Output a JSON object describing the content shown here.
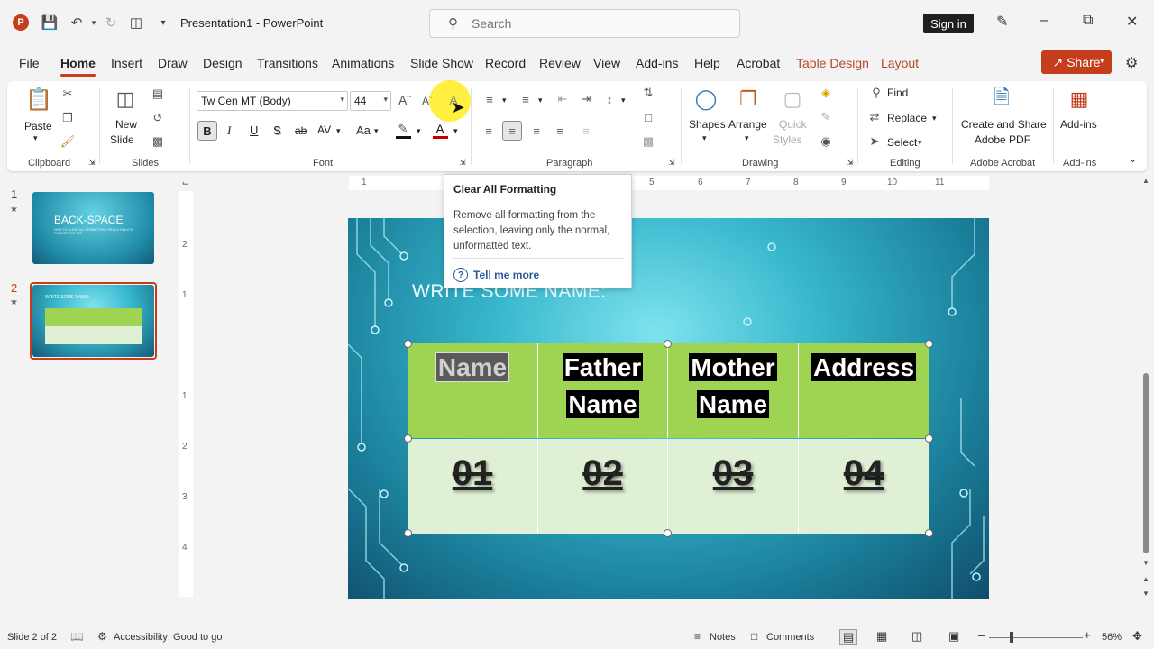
{
  "app": {
    "logo_letter": "P",
    "doc_title": "Presentation1  -  PowerPoint",
    "search_placeholder": "Search",
    "signin_label": "Sign in",
    "share_label": "Share"
  },
  "tabs": [
    "File",
    "Home",
    "Insert",
    "Draw",
    "Design",
    "Transitions",
    "Animations",
    "Slide Show",
    "Record",
    "Review",
    "View",
    "Add-ins",
    "Help",
    "Acrobat",
    "Table Design",
    "Layout"
  ],
  "ribbon": {
    "clipboard": {
      "paste": "Paste",
      "label": "Clipboard"
    },
    "slides": {
      "new_slide": "New",
      "new_slide2": "Slide",
      "label": "Slides"
    },
    "font": {
      "font_name": "Tw Cen MT (Body)",
      "font_size": "44",
      "label": "Font",
      "bold": "B",
      "italic": "I",
      "underline": "U",
      "strike": "S",
      "abc": "ab",
      "av": "AV",
      "aa": "Aa"
    },
    "paragraph": {
      "label": "Paragraph"
    },
    "drawing": {
      "shapes": "Shapes",
      "arrange": "Arrange",
      "quick": "Quick",
      "styles": "Styles",
      "label": "Drawing"
    },
    "editing": {
      "find": "Find",
      "replace": "Replace",
      "select": "Select",
      "label": "Editing"
    },
    "acrobat": {
      "line1": "Create and Share",
      "line2": "Adobe PDF",
      "label": "Adobe Acrobat"
    },
    "addins": {
      "btn": "Add-ins",
      "label": "Add-ins"
    }
  },
  "tooltip": {
    "title": "Clear All Formatting",
    "body": "Remove all formatting from the selection, leaving only the normal, unformatted text.",
    "more": "Tell me more"
  },
  "thumbnails": [
    {
      "num": "1",
      "title": "BACK-SPACE",
      "subtitle": "HOW TO CLEAR ALL FORMATTING FROM A TABLE IN POWERPOINT 365"
    },
    {
      "num": "2",
      "title": "WRITE SOME NAME:"
    }
  ],
  "ruler": {
    "h": [
      "1",
      "5",
      "6",
      "7",
      "8",
      "9",
      "10",
      "11"
    ],
    "v": [
      "2",
      "1",
      "1",
      "2",
      "3",
      "4"
    ]
  },
  "slide": {
    "title": "WRITE SOME NAME:",
    "table": {
      "headers": [
        "Name",
        "Father Name",
        "Mother Name",
        "Address"
      ],
      "header_lines": [
        [
          "Name"
        ],
        [
          "Father",
          "Name"
        ],
        [
          "Mother",
          "Name"
        ],
        [
          "Address"
        ]
      ],
      "row": [
        "01",
        "02",
        "03",
        "04"
      ]
    }
  },
  "status": {
    "slide_of": "Slide 2 of 2",
    "accessibility": "Accessibility: Good to go",
    "notes": "Notes",
    "comments": "Comments",
    "zoom": "56%"
  },
  "colors": {
    "accent": "#c43e1c",
    "header_cell": "#9ed452",
    "body_cell": "#dff0d4",
    "slide_bg": "#36b6cc"
  }
}
